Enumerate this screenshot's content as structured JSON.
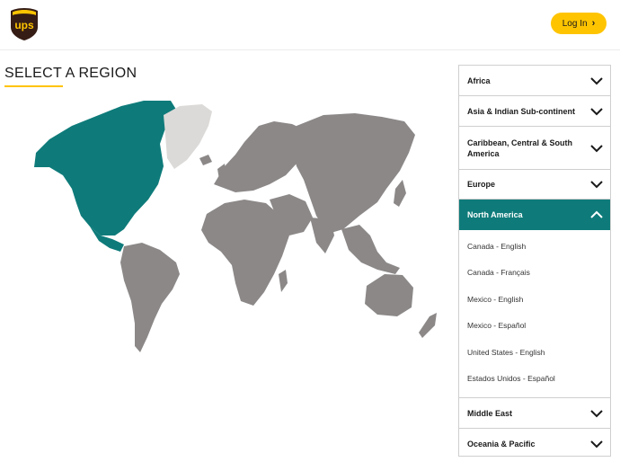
{
  "header": {
    "logo_text": "ups",
    "login_label": "Log In",
    "login_chevron": "›"
  },
  "page": {
    "title": "SELECT A REGION"
  },
  "map": {
    "highlighted_region": "North America",
    "colors": {
      "highlight": "#0e7b7a",
      "land": "#8c8888",
      "greenland": "#dcdad8"
    }
  },
  "regions": [
    {
      "label": "Africa",
      "expanded": false
    },
    {
      "label": "Asia & Indian Sub-continent",
      "expanded": false
    },
    {
      "label": "Caribbean, Central & South America",
      "expanded": false
    },
    {
      "label": "Europe",
      "expanded": false
    },
    {
      "label": "North America",
      "expanded": true,
      "items": [
        "Canada - English",
        "Canada - Français",
        "Mexico - English",
        "Mexico - Español",
        "United States - English",
        "Estados Unidos - Español"
      ]
    },
    {
      "label": "Middle East",
      "expanded": false
    },
    {
      "label": "Oceania & Pacific",
      "expanded": false
    }
  ],
  "colors": {
    "accent": "#ffc400",
    "brand_brown": "#351c15",
    "active_bg": "#0e7b7a"
  },
  "icons": {
    "collapsed": "chevron-down-icon",
    "expanded": "chevron-up-icon"
  }
}
